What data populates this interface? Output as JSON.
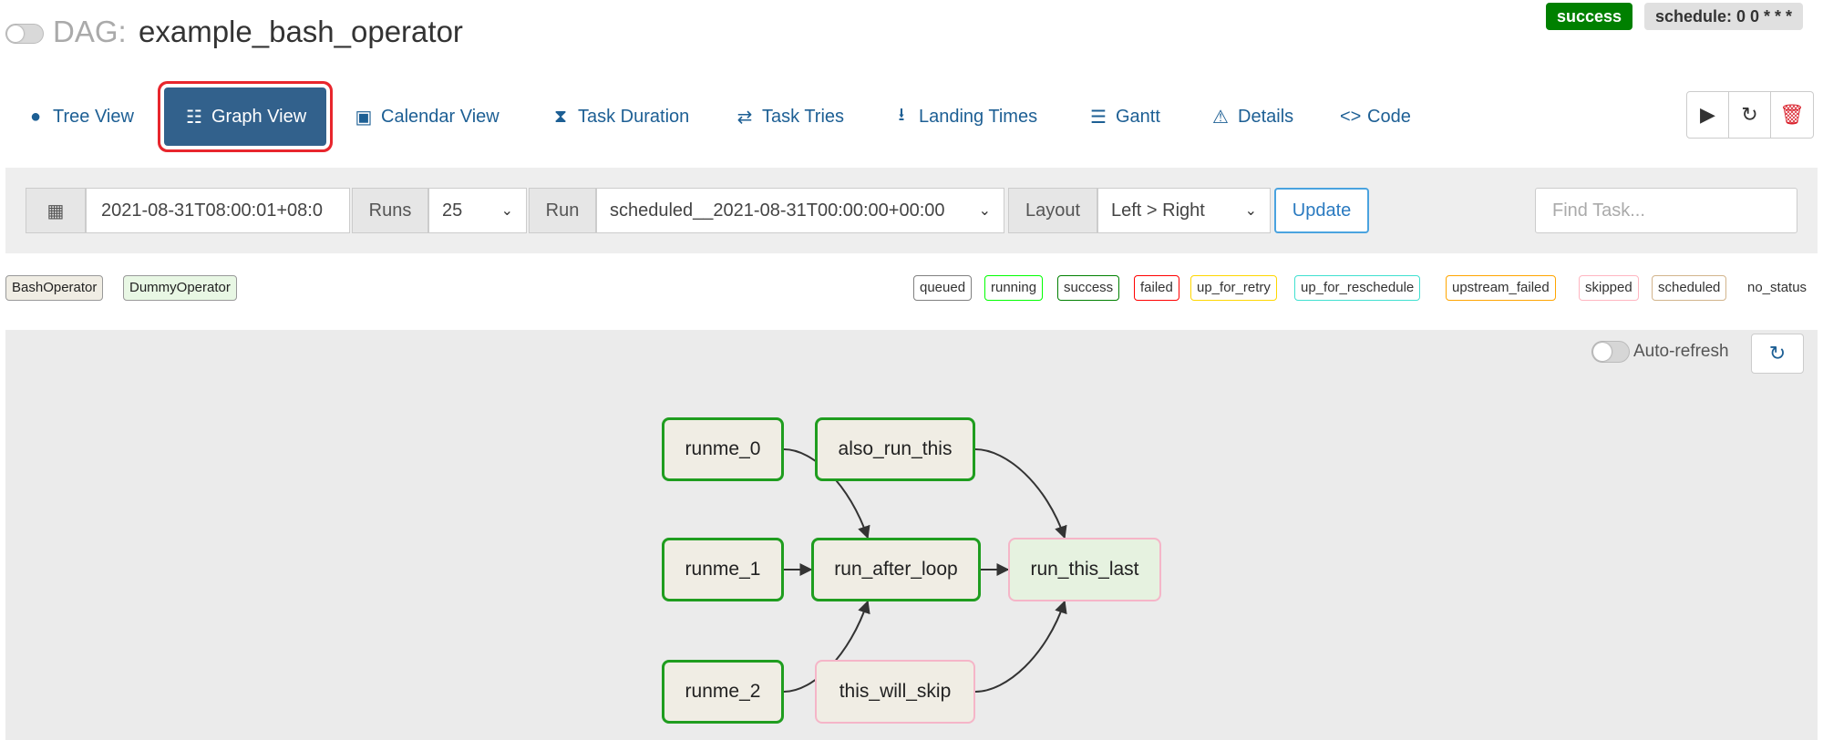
{
  "header": {
    "dag_label": "DAG:",
    "dag_name": "example_bash_operator",
    "status_badge": "success",
    "schedule_badge": "schedule: 0 0 * * *"
  },
  "nav": {
    "items": [
      {
        "label": "Tree View",
        "icon": "tree-icon",
        "glyph": "●",
        "active": false
      },
      {
        "label": "Graph View",
        "icon": "graph-icon",
        "glyph": "☷",
        "active": true
      },
      {
        "label": "Calendar View",
        "icon": "calendar-icon",
        "glyph": "▣",
        "active": false
      },
      {
        "label": "Task Duration",
        "icon": "hourglass-icon",
        "glyph": "⧗",
        "active": false
      },
      {
        "label": "Task Tries",
        "icon": "retry-icon",
        "glyph": "⇄",
        "active": false
      },
      {
        "label": "Landing Times",
        "icon": "landing-icon",
        "glyph": "⭳",
        "active": false
      },
      {
        "label": "Gantt",
        "icon": "gantt-icon",
        "glyph": "☰",
        "active": false
      },
      {
        "label": "Details",
        "icon": "warning-icon",
        "glyph": "⚠",
        "active": false
      },
      {
        "label": "Code",
        "icon": "code-icon",
        "glyph": "<>",
        "active": false
      }
    ],
    "actions": [
      {
        "icon": "play-icon",
        "glyph": "▶"
      },
      {
        "icon": "refresh-icon",
        "glyph": "↻"
      },
      {
        "icon": "delete-icon",
        "glyph": "🗑"
      }
    ]
  },
  "filters": {
    "calendar_glyph": "▦",
    "base_date": "2021-08-31T08:00:01+08:0",
    "runs_label": "Runs",
    "runs_value": "25",
    "run_label": "Run",
    "run_value": "scheduled__2021-08-31T00:00:00+00:00",
    "layout_label": "Layout",
    "layout_value": "Left > Right",
    "update_label": "Update",
    "find_task_placeholder": "Find Task..."
  },
  "operators": [
    {
      "label": "BashOperator",
      "bg": "#f0ede4"
    },
    {
      "label": "DummyOperator",
      "bg": "#e8f7e4"
    }
  ],
  "states": [
    {
      "label": "queued",
      "color": "#808080"
    },
    {
      "label": "running",
      "color": "#00ff00"
    },
    {
      "label": "success",
      "color": "#008000"
    },
    {
      "label": "failed",
      "color": "#ff0000"
    },
    {
      "label": "up_for_retry",
      "color": "#ffd700"
    },
    {
      "label": "up_for_reschedule",
      "color": "#40e0d0"
    },
    {
      "label": "upstream_failed",
      "color": "#ffa500"
    },
    {
      "label": "skipped",
      "color": "#ffb6c1"
    },
    {
      "label": "scheduled",
      "color": "#d2b48c"
    }
  ],
  "no_status_label": "no_status",
  "graph": {
    "autorefresh_label": "Auto-refresh",
    "refresh_glyph": "↻",
    "nodes": [
      {
        "id": "runme_0",
        "label": "runme_0",
        "state": "success"
      },
      {
        "id": "also_run_this",
        "label": "also_run_this",
        "state": "success"
      },
      {
        "id": "runme_1",
        "label": "runme_1",
        "state": "success"
      },
      {
        "id": "run_after_loop",
        "label": "run_after_loop",
        "state": "success"
      },
      {
        "id": "run_this_last",
        "label": "run_this_last",
        "state": "skipped"
      },
      {
        "id": "runme_2",
        "label": "runme_2",
        "state": "success"
      },
      {
        "id": "this_will_skip",
        "label": "this_will_skip",
        "state": "skipped"
      }
    ],
    "edges": [
      [
        "runme_0",
        "run_after_loop"
      ],
      [
        "runme_1",
        "run_after_loop"
      ],
      [
        "runme_2",
        "run_after_loop"
      ],
      [
        "also_run_this",
        "run_this_last"
      ],
      [
        "run_after_loop",
        "run_this_last"
      ],
      [
        "this_will_skip",
        "run_this_last"
      ]
    ]
  }
}
